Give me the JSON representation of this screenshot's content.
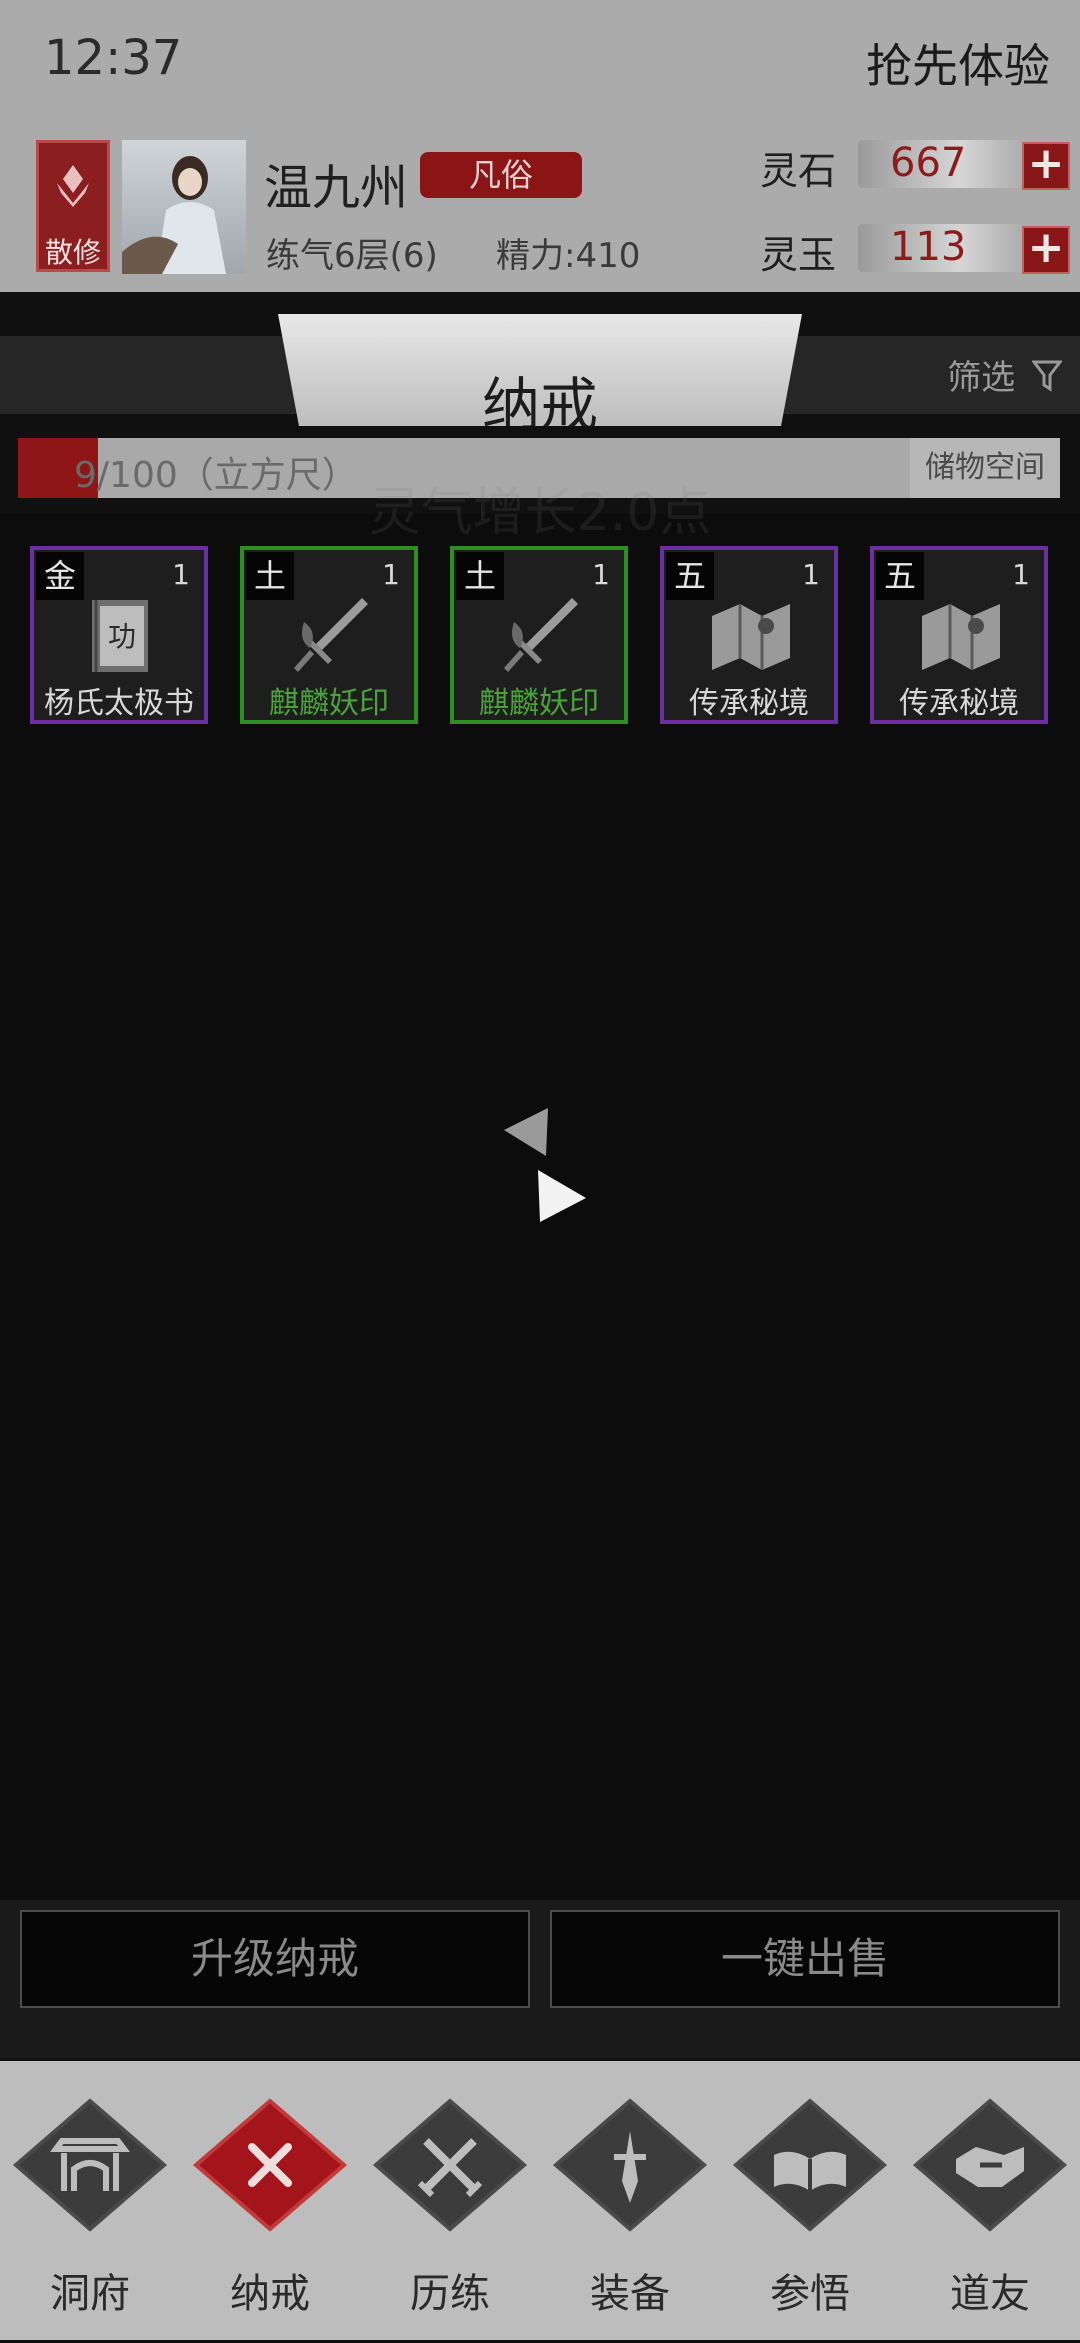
{
  "status_bar": {
    "time": "12:37",
    "early_access": "抢先体验"
  },
  "player": {
    "sect_label": "散修",
    "name": "温九州",
    "rank": "凡俗",
    "realm": "练气6层(6)",
    "energy": "精力:410"
  },
  "currencies": [
    {
      "label": "灵石",
      "value": "667",
      "icon": "plus-icon"
    },
    {
      "label": "灵玉",
      "value": "113",
      "icon": "plus-icon"
    }
  ],
  "page": {
    "title": "纳戒",
    "filter_label": "筛选",
    "capacity_text": "9/100（立方尺）",
    "capacity_fraction": 0.09,
    "storage_button": "储物空间",
    "ghost_text": "灵气增长2.0点"
  },
  "items": [
    {
      "element": "金",
      "qty": "1",
      "name": "杨氏太极书",
      "rarity": "purple",
      "icon": "technique-book-icon"
    },
    {
      "element": "土",
      "qty": "1",
      "name": "麒麟妖印",
      "rarity": "green",
      "icon": "sword-icon"
    },
    {
      "element": "土",
      "qty": "1",
      "name": "麒麟妖印",
      "rarity": "green",
      "icon": "sword-icon"
    },
    {
      "element": "五",
      "qty": "1",
      "name": "传承秘境",
      "rarity": "purple",
      "icon": "map-scroll-icon"
    },
    {
      "element": "五",
      "qty": "1",
      "name": "传承秘境",
      "rarity": "purple",
      "icon": "map-scroll-icon"
    }
  ],
  "actions": {
    "upgrade": "升级纳戒",
    "sell_all": "一键出售"
  },
  "nav": [
    {
      "label": "洞府",
      "icon": "gate-icon"
    },
    {
      "label": "纳戒",
      "icon": "close-icon",
      "active": true
    },
    {
      "label": "历练",
      "icon": "crossed-swords-icon"
    },
    {
      "label": "装备",
      "icon": "dagger-icon"
    },
    {
      "label": "参悟",
      "icon": "open-book-icon"
    },
    {
      "label": "道友",
      "icon": "handshake-icon"
    }
  ],
  "colors": {
    "accent_red": "#8e1616",
    "rarity_purple": "#6b2fa3",
    "rarity_green": "#2d8f20"
  }
}
